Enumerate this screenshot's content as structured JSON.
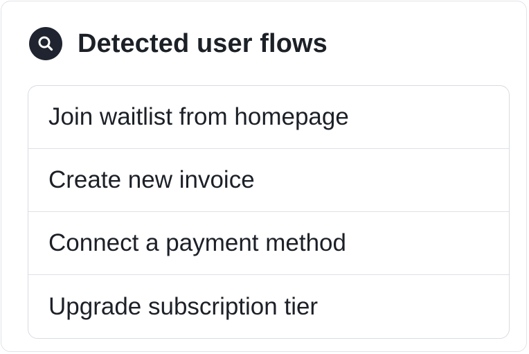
{
  "panel": {
    "title": "Detected user flows",
    "icon": "search-icon"
  },
  "flows": [
    {
      "label": "Join waitlist from homepage"
    },
    {
      "label": "Create new invoice"
    },
    {
      "label": "Connect a payment method"
    },
    {
      "label": "Upgrade subscription tier"
    }
  ],
  "colors": {
    "icon_background": "#1f2430",
    "text": "#1c2027",
    "border": "#d8dbe2"
  }
}
